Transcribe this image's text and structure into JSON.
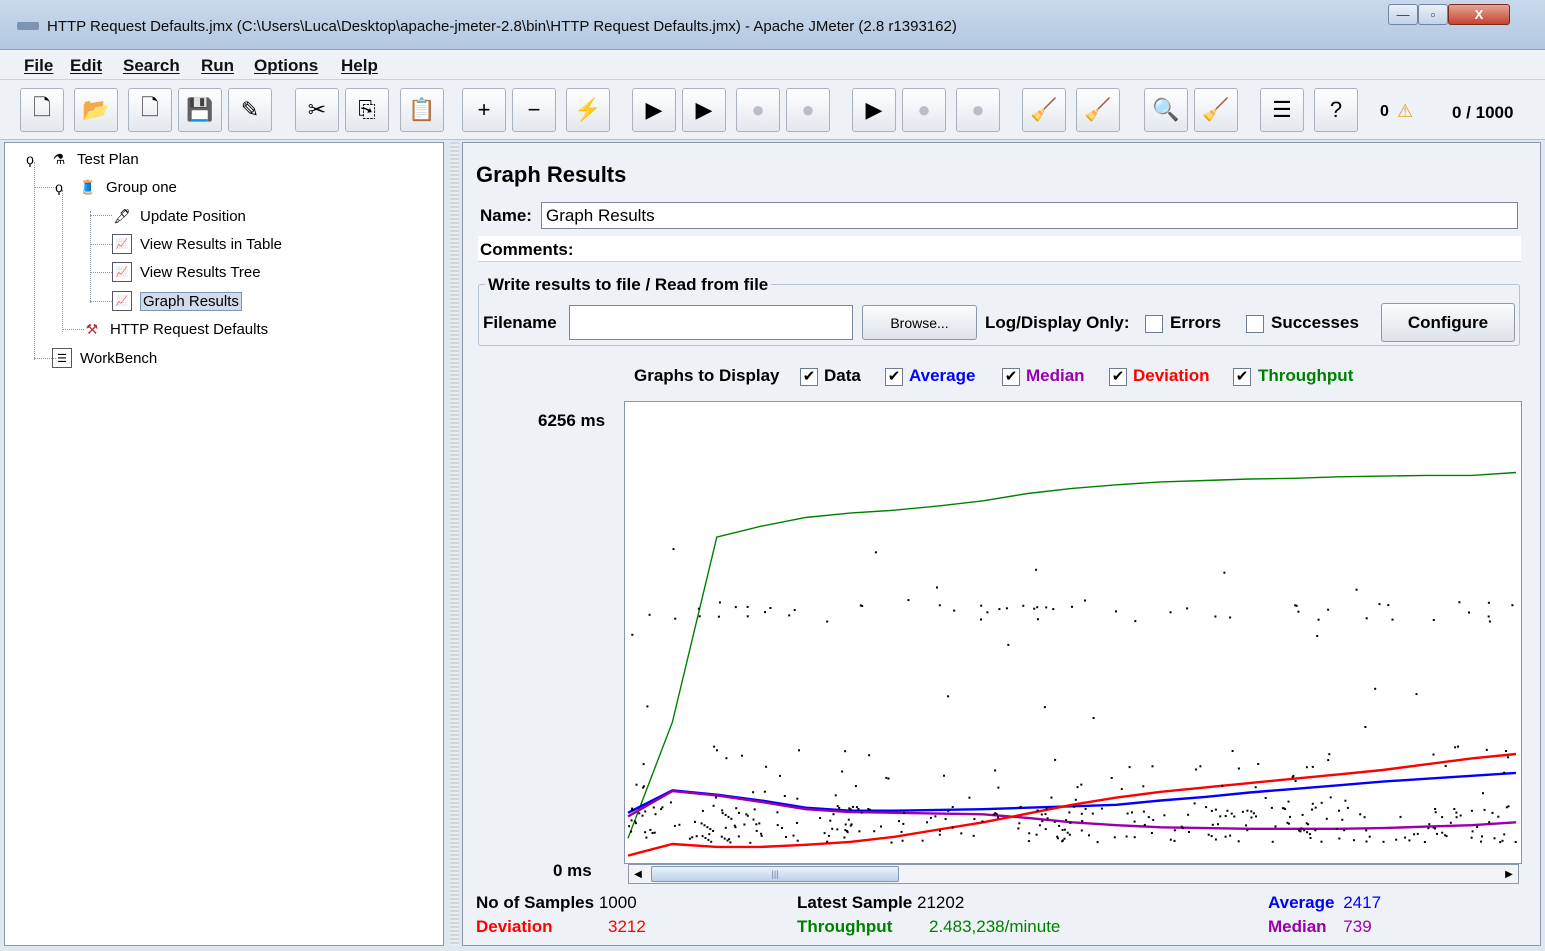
{
  "window": {
    "title": "HTTP Request Defaults.jmx (C:\\Users\\Luca\\Desktop\\apache-jmeter-2.8\\bin\\HTTP Request Defaults.jmx) - Apache JMeter (2.8 r1393162)",
    "minimize": "—",
    "maximize": "▫",
    "close": "X"
  },
  "menu": [
    "File",
    "Edit",
    "Search",
    "Run",
    "Options",
    "Help"
  ],
  "toolbar": {
    "warning_count": "0",
    "warning_icon": "⚠",
    "threads": "0 / 1000",
    "buttons": [
      {
        "name": "new-icon",
        "glyph": "🗋"
      },
      {
        "name": "open-icon",
        "glyph": "📂"
      },
      {
        "name": "close-file-icon",
        "glyph": "🗋"
      },
      {
        "name": "save-icon",
        "glyph": "💾"
      },
      {
        "name": "save-as-icon",
        "glyph": "✎"
      },
      {
        "name": "cut-icon",
        "glyph": "✂"
      },
      {
        "name": "copy-icon",
        "glyph": "⎘"
      },
      {
        "name": "paste-icon",
        "glyph": "📋"
      },
      {
        "name": "expand-icon",
        "glyph": "+"
      },
      {
        "name": "collapse-icon",
        "glyph": "−"
      },
      {
        "name": "toggle-icon",
        "glyph": "⚡"
      },
      {
        "name": "start-icon",
        "glyph": "▶"
      },
      {
        "name": "start-no-pause-icon",
        "glyph": "▶"
      },
      {
        "name": "stop-icon",
        "glyph": "●"
      },
      {
        "name": "shutdown-icon",
        "glyph": "●"
      },
      {
        "name": "remote-start-icon",
        "glyph": "▶"
      },
      {
        "name": "remote-stop-icon",
        "glyph": "●"
      },
      {
        "name": "remote-shutdown-icon",
        "glyph": "●"
      },
      {
        "name": "clear-icon",
        "glyph": "🧹"
      },
      {
        "name": "clear-all-icon",
        "glyph": "🧹"
      },
      {
        "name": "search-icon",
        "glyph": "🔍"
      },
      {
        "name": "reset-search-icon",
        "glyph": "🧹"
      },
      {
        "name": "function-helper-icon",
        "glyph": "☰"
      },
      {
        "name": "help-icon",
        "glyph": "?"
      }
    ]
  },
  "tree": {
    "test_plan": "Test Plan",
    "group_one": "Group one",
    "update_position": "Update Position",
    "view_results_table": "View Results in Table",
    "view_results_tree": "View Results Tree",
    "graph_results": "Graph Results",
    "http_defaults": "HTTP Request Defaults",
    "workbench": "WorkBench"
  },
  "panel": {
    "title": "Graph Results",
    "name_label": "Name:",
    "name_value": "Graph Results",
    "comments_label": "Comments:",
    "file_section_title": "Write results to file / Read from file",
    "filename_label": "Filename",
    "filename_value": "",
    "browse_label": "Browse...",
    "log_display_label": "Log/Display Only:",
    "errors_label": "Errors",
    "successes_label": "Successes",
    "configure_label": "Configure",
    "graphs_to_display_label": "Graphs to Display",
    "graph_options": [
      {
        "label": "Data",
        "color": "#000000",
        "checked": true
      },
      {
        "label": "Average",
        "color": "#0000ff",
        "checked": true
      },
      {
        "label": "Median",
        "color": "#9900aa",
        "checked": true
      },
      {
        "label": "Deviation",
        "color": "#ff0000",
        "checked": true
      },
      {
        "label": "Throughput",
        "color": "#008000",
        "checked": true
      }
    ],
    "check_mark": "✔",
    "y_max_label": "6256  ms",
    "y_min_label": "0  ms"
  },
  "stats": {
    "samples_label": "No of Samples",
    "samples_value": "1000",
    "latest_label": "Latest Sample",
    "latest_value": "21202",
    "average_label": "Average",
    "average_value": "2417",
    "deviation_label": "Deviation",
    "deviation_value": "3212",
    "throughput_label": "Throughput",
    "throughput_value": "2.483,238/minute",
    "median_label": "Median",
    "median_value": "739"
  },
  "chart_data": {
    "type": "line",
    "ylim": [
      0,
      6256
    ],
    "yunit": "ms",
    "colors": {
      "data": "#000000",
      "average": "#0000ff",
      "median": "#9900aa",
      "deviation": "#ff0000",
      "throughput": "#008000"
    },
    "x": [
      0,
      50,
      100,
      150,
      200,
      250,
      300,
      350,
      400,
      450,
      500,
      550,
      600,
      650,
      700,
      750,
      800,
      850,
      900,
      950,
      1000
    ],
    "series": [
      {
        "name": "Throughput",
        "values": [
          300,
          1900,
          4450,
          4600,
          4720,
          4780,
          4820,
          4880,
          4950,
          5050,
          5120,
          5170,
          5210,
          5230,
          5250,
          5260,
          5280,
          5290,
          5300,
          5300,
          5340
        ]
      },
      {
        "name": "Average",
        "values": [
          650,
          960,
          900,
          820,
          720,
          680,
          680,
          690,
          700,
          720,
          740,
          760,
          820,
          870,
          930,
          980,
          1030,
          1080,
          1120,
          1160,
          1200
        ]
      },
      {
        "name": "Median",
        "values": [
          600,
          950,
          890,
          800,
          700,
          660,
          650,
          640,
          630,
          580,
          520,
          480,
          450,
          440,
          430,
          430,
          430,
          440,
          460,
          480,
          520
        ]
      },
      {
        "name": "Deviation",
        "values": [
          60,
          220,
          180,
          180,
          210,
          250,
          320,
          420,
          520,
          640,
          760,
          860,
          940,
          1000,
          1060,
          1120,
          1180,
          1240,
          1320,
          1400,
          1460
        ]
      }
    ]
  }
}
